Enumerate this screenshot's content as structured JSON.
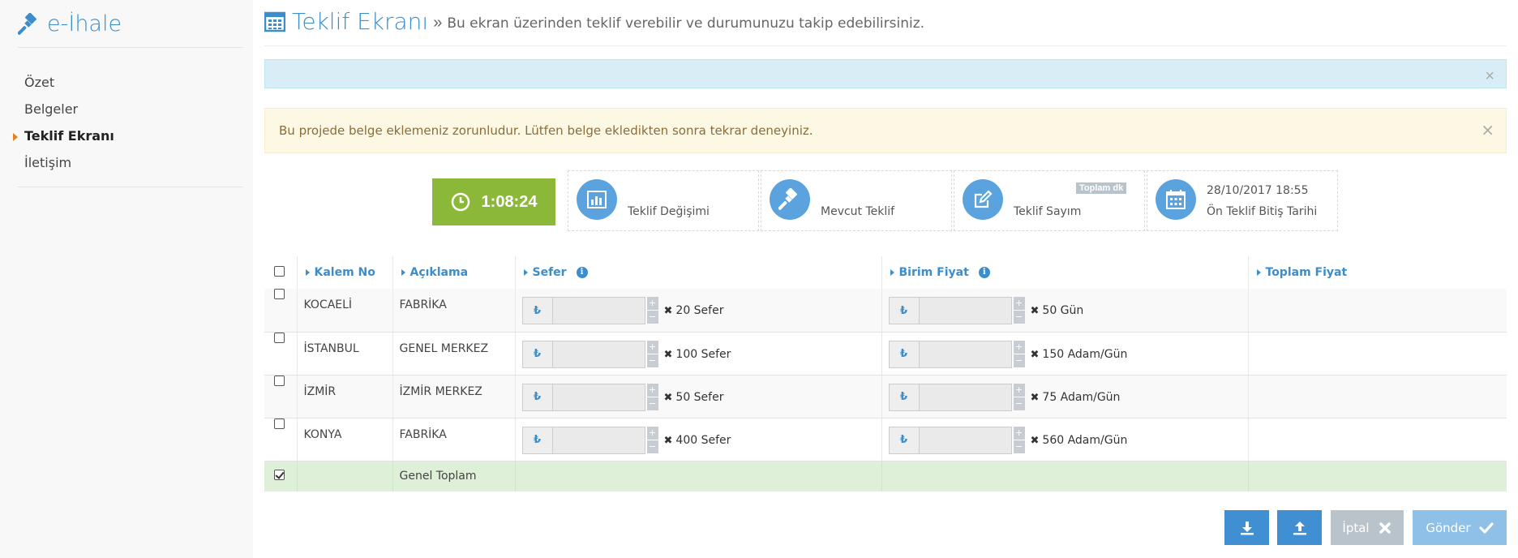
{
  "brand": {
    "name": "e-İhale"
  },
  "sidebar": {
    "items": [
      {
        "label": "Özet",
        "active": false
      },
      {
        "label": "Belgeler",
        "active": false
      },
      {
        "label": "Teklif Ekranı",
        "active": true
      },
      {
        "label": "İletişim",
        "active": false
      }
    ]
  },
  "header": {
    "title": "Teklif Ekranı",
    "separator": "»",
    "subtitle": "Bu ekran üzerinden teklif verebilir ve durumunuzu takip edebilirsiniz."
  },
  "alerts": {
    "info_close": "×",
    "warning": "Bu projede belge eklemeniz zorunludur. Lütfen belge ekledikten sonra tekrar deneyiniz.",
    "warning_close": "×"
  },
  "stats": {
    "timer": "1:08:24",
    "cards": [
      {
        "label": "Teklif Değişimi",
        "value": "",
        "badge": ""
      },
      {
        "label": "Mevcut Teklif",
        "value": "",
        "badge": ""
      },
      {
        "label": "Teklif Sayım",
        "value": "",
        "badge": "Toplam dk"
      },
      {
        "label": "Ön Teklif Bitiş Tarihi",
        "value": "28/10/2017 18:55",
        "badge": ""
      }
    ]
  },
  "table": {
    "headers": [
      "Kalem No",
      "Açıklama",
      "Sefer",
      "Birim Fiyat",
      "Toplam Fiyat"
    ],
    "currency_symbol": "₺",
    "multiply_symbol": "✖",
    "rows": [
      {
        "kalem": "KOCAELİ",
        "aciklama": "FABRİKA",
        "sefer": "20 Sefer",
        "birim": "50 Gün"
      },
      {
        "kalem": "İSTANBUL",
        "aciklama": "GENEL MERKEZ",
        "sefer": "100 Sefer",
        "birim": "150 Adam/Gün"
      },
      {
        "kalem": "İZMİR",
        "aciklama": "İZMİR MERKEZ",
        "sefer": "50 Sefer",
        "birim": "75 Adam/Gün"
      },
      {
        "kalem": "KONYA",
        "aciklama": "FABRİKA",
        "sefer": "400 Sefer",
        "birim": "560 Adam/Gün"
      }
    ],
    "total_label": "Genel Toplam"
  },
  "buttons": {
    "cancel": "İptal",
    "send": "Gönder"
  },
  "colors": {
    "primary": "#3c8dcb",
    "timer": "#8cb83a",
    "icon_circle": "#5aa3df",
    "total_row": "#dff0d8"
  }
}
